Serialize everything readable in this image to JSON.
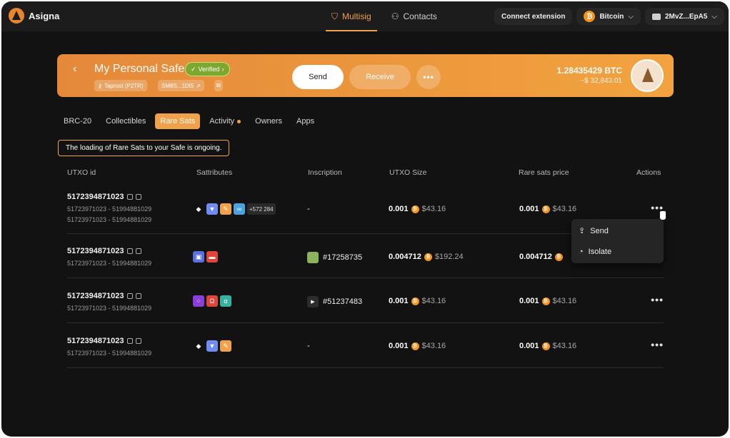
{
  "app": {
    "name": "Asigna"
  },
  "nav": {
    "multisig": "Multisig",
    "contacts": "Contacts"
  },
  "topbar": {
    "connect": "Connect extension",
    "network": "Bitcoin",
    "wallet": "2MvZ...EpA5"
  },
  "safe": {
    "name": "My Personal Safe",
    "verified": "Verified",
    "type_chip": "Taproot (P2TR)",
    "address_chip": "SM8S...1Dt5",
    "send": "Send",
    "receive": "Receive",
    "more": "•••",
    "balance_btc": "1.28435429 BTC",
    "balance_usd": "~$ 32,843.01"
  },
  "tabs": [
    "BRC-20",
    "Collectibles",
    "Rare Sats",
    "Activity",
    "Owners",
    "Apps"
  ],
  "notice": "The loading of Rare Sats to your Safe is ongoing.",
  "table": {
    "headers": [
      "UTXO id",
      "Sattributes",
      "Inscription",
      "UTXO Size",
      "Rare sats price",
      "Actions"
    ],
    "rows": [
      {
        "id": "5172394871023",
        "ranges": [
          "51723971023 - 51994881029",
          "51723971023 - 51994881029"
        ],
        "extra": "+572 284",
        "inscription": "-",
        "size_btc": "0.001",
        "size_usd": "$43.16",
        "price_btc": "0.001",
        "price_usd": "$43.16"
      },
      {
        "id": "5172394871023",
        "ranges": [
          "51723971023 - 51994881029"
        ],
        "inscription": "#17258735",
        "size_btc": "0.004712",
        "size_usd": "$192.24",
        "price_btc": "0.004712",
        "price_usd": ""
      },
      {
        "id": "5172394871023",
        "ranges": [
          "51723971023 - 51994881029"
        ],
        "inscription": "#51237483",
        "size_btc": "0.001",
        "size_usd": "$43.16",
        "price_btc": "0.001",
        "price_usd": "$43.16"
      },
      {
        "id": "5172394871023",
        "ranges": [
          "51723971023 - 51994881029"
        ],
        "inscription": "-",
        "size_btc": "0.001",
        "size_usd": "$43.16",
        "price_btc": "0.001",
        "price_usd": "$43.16"
      }
    ]
  },
  "dropdown": {
    "send": "Send",
    "isolate": "Isolate"
  },
  "actions_label": "•••"
}
